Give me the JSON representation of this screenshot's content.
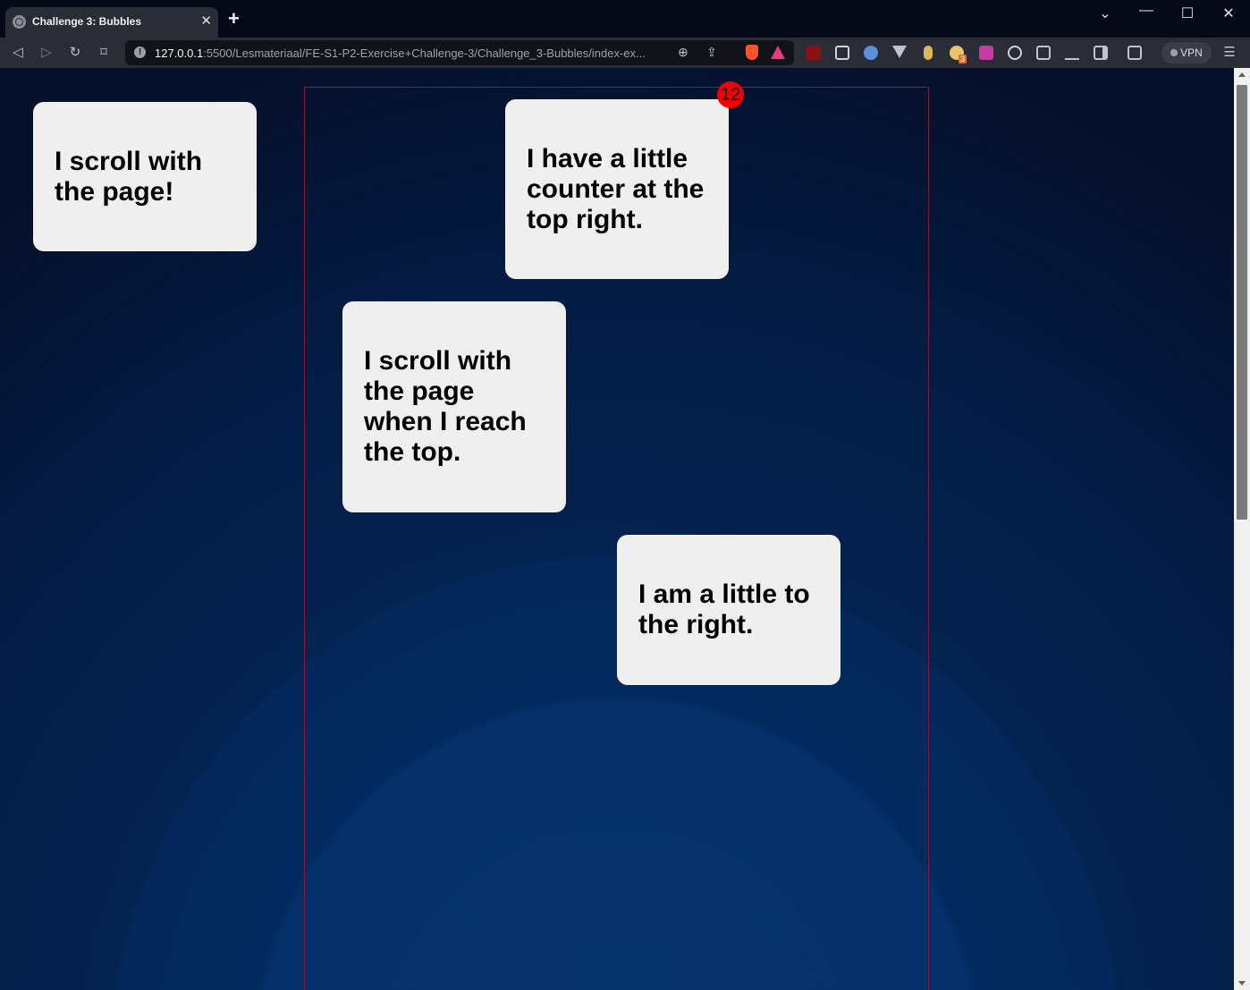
{
  "browser": {
    "tab": {
      "title": "Challenge 3: Bubbles",
      "close": "✕"
    },
    "new_tab": "+",
    "window_controls": {
      "list": "⌄",
      "minimize": "—",
      "maximize": "☐",
      "close": "✕"
    },
    "nav": {
      "back": "◁",
      "forward": "▷",
      "reload": "↻",
      "bookmark": "⌑"
    },
    "url": {
      "host": "127.0.0.1",
      "rest": ":5500/Lesmateriaal/FE-S1-P2-Exercise+Challenge-3/Challenge_3-Bubbles/index-ex...",
      "info_icon": "!"
    },
    "url_actions": {
      "zoom": "⊕",
      "share": "⇪"
    },
    "extensions": [
      "ublock-icon",
      "screenshot-icon",
      "search-icon",
      "vue-icon",
      "extension-icon",
      "bulb-icon",
      "chart-icon",
      "shield-icon",
      "puzzle-icon",
      "download-icon",
      "sidebar-icon",
      "wallet-icon"
    ],
    "extension_badge": "3",
    "vpn_label": "VPN",
    "menu": "☰"
  },
  "page": {
    "bubbles": [
      {
        "text": "I scroll with the page!"
      },
      {
        "text": "I have a little counter at the top right."
      },
      {
        "text": "I scroll with the page when I reach the top."
      },
      {
        "text": "I am a little to the right."
      }
    ],
    "counter": "12"
  },
  "colors": {
    "page_bg": "#06102b",
    "bubble_bg": "#efefef",
    "counter_bg": "#f00000",
    "container_border": "#8a1833"
  }
}
